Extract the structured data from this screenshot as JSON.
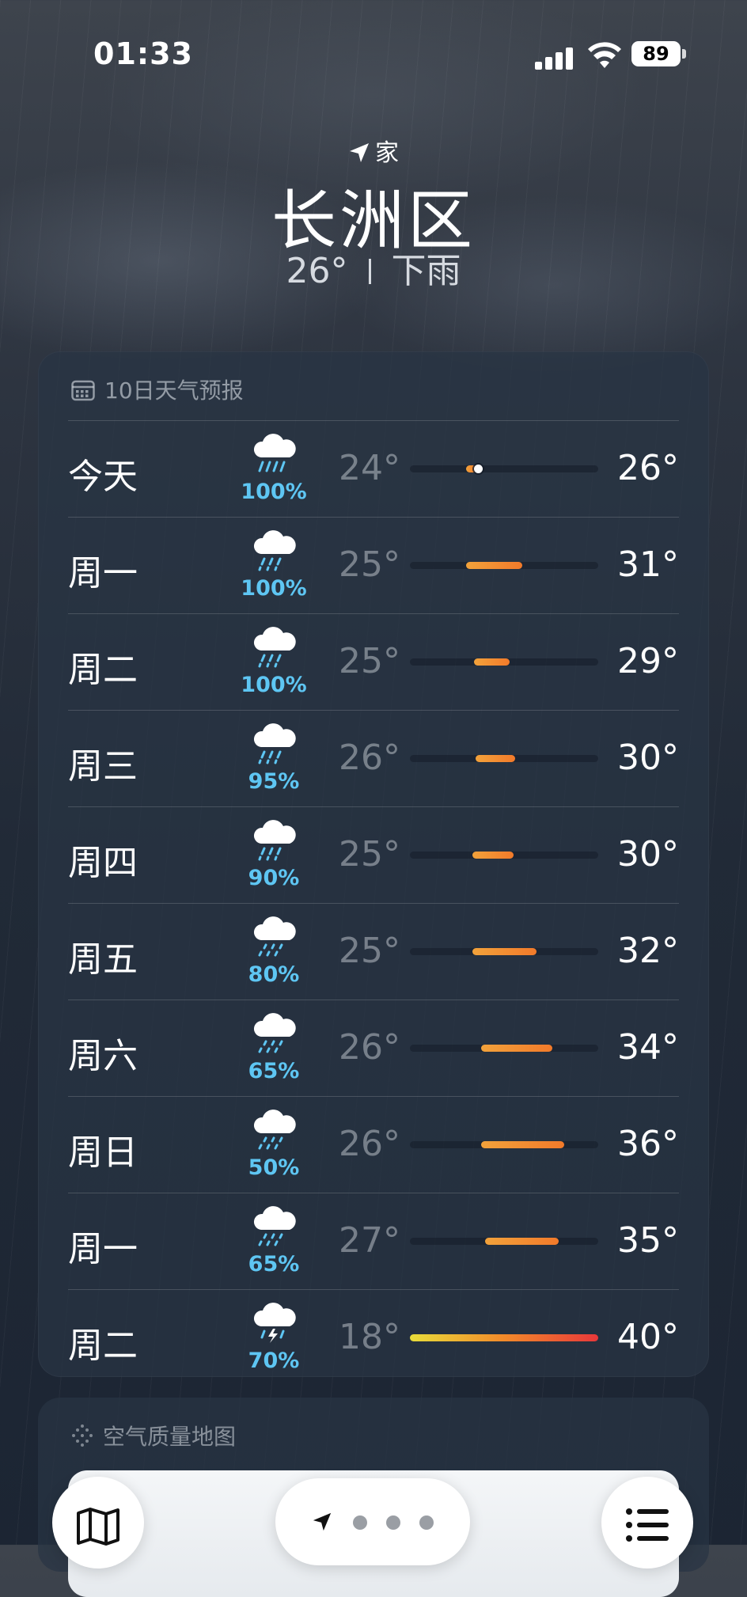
{
  "status": {
    "time": "01:33",
    "battery": "89"
  },
  "header": {
    "location_label": "家",
    "city": "长洲区",
    "current_temp": "26°",
    "condition": "下雨"
  },
  "forecast": {
    "title": "10日天气预报",
    "days": [
      {
        "day": "今天",
        "precip": "100%",
        "low": "24°",
        "high": "26°",
        "icon": "heavy-rain-icon",
        "bar_start": 0.3,
        "bar_end": 0.36,
        "current_dot": 0.36
      },
      {
        "day": "周一",
        "precip": "100%",
        "low": "25°",
        "high": "31°",
        "icon": "rain-icon",
        "bar_start": 0.3,
        "bar_end": 0.6
      },
      {
        "day": "周二",
        "precip": "100%",
        "low": "25°",
        "high": "29°",
        "icon": "rain-icon",
        "bar_start": 0.34,
        "bar_end": 0.53
      },
      {
        "day": "周三",
        "precip": "95%",
        "low": "26°",
        "high": "30°",
        "icon": "rain-icon",
        "bar_start": 0.35,
        "bar_end": 0.56
      },
      {
        "day": "周四",
        "precip": "90%",
        "low": "25°",
        "high": "30°",
        "icon": "rain-icon",
        "bar_start": 0.33,
        "bar_end": 0.55
      },
      {
        "day": "周五",
        "precip": "80%",
        "low": "25°",
        "high": "32°",
        "icon": "light-rain-icon",
        "bar_start": 0.33,
        "bar_end": 0.67
      },
      {
        "day": "周六",
        "precip": "65%",
        "low": "26°",
        "high": "34°",
        "icon": "light-rain-icon",
        "bar_start": 0.38,
        "bar_end": 0.76
      },
      {
        "day": "周日",
        "precip": "50%",
        "low": "26°",
        "high": "36°",
        "icon": "light-rain-icon",
        "bar_start": 0.38,
        "bar_end": 0.82
      },
      {
        "day": "周一",
        "precip": "65%",
        "low": "27°",
        "high": "35°",
        "icon": "light-rain-icon",
        "bar_start": 0.4,
        "bar_end": 0.79
      },
      {
        "day": "周二",
        "precip": "70%",
        "low": "18°",
        "high": "40°",
        "icon": "thunderstorm-icon",
        "bar_start": 0.0,
        "bar_end": 1.0,
        "gradient": [
          "#e8dc3a",
          "#f28a2a",
          "#e8383a"
        ]
      }
    ]
  },
  "air_quality": {
    "title": "空气质量地图"
  },
  "colors": {
    "precip": "#5ec6f3",
    "bar_warm": "#f2a23b",
    "bar_hot": "#e8383a"
  }
}
